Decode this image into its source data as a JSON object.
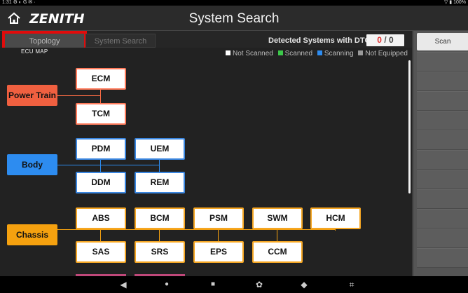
{
  "status_bar": {
    "time": "1:31",
    "icons_left": "⚙ ◐ G ✉ ·",
    "battery": "▽ ▮ 100%"
  },
  "header": {
    "logo": "ZENITH",
    "title": "System Search"
  },
  "tabs": {
    "topology": "Topology",
    "system_search": "System Search"
  },
  "dtc": {
    "label": "Detected Systems with DTC:",
    "count": "0",
    "separator": "/",
    "total": "0"
  },
  "map": {
    "label": "ECU MAP",
    "legend": [
      {
        "label": "Not Scanned",
        "color": "#ffffff"
      },
      {
        "label": "Scanned",
        "color": "#3cc84a"
      },
      {
        "label": "Scanning",
        "color": "#2d8cf0"
      },
      {
        "label": "Not Equipped",
        "color": "#9a9a9a"
      }
    ],
    "groups": {
      "power_train": {
        "label": "Power Train",
        "color": "#f06040",
        "modules": [
          "ECM",
          "TCM"
        ]
      },
      "body": {
        "label": "Body",
        "color": "#2d8cf0",
        "modules": [
          "PDM",
          "UEM",
          "DDM",
          "REM"
        ]
      },
      "chassis": {
        "label": "Chassis",
        "color": "#f5a10f",
        "modules": [
          "ABS",
          "BCM",
          "PSM",
          "SWM",
          "HCM",
          "SAS",
          "SRS",
          "EPS",
          "CCM"
        ]
      }
    }
  },
  "right_panel": {
    "scan_label": "Scan"
  },
  "nav": {
    "back": "◀",
    "home": "●",
    "recents": "■",
    "gear": "✿",
    "browser": "◆",
    "screenshot": "⌗"
  }
}
